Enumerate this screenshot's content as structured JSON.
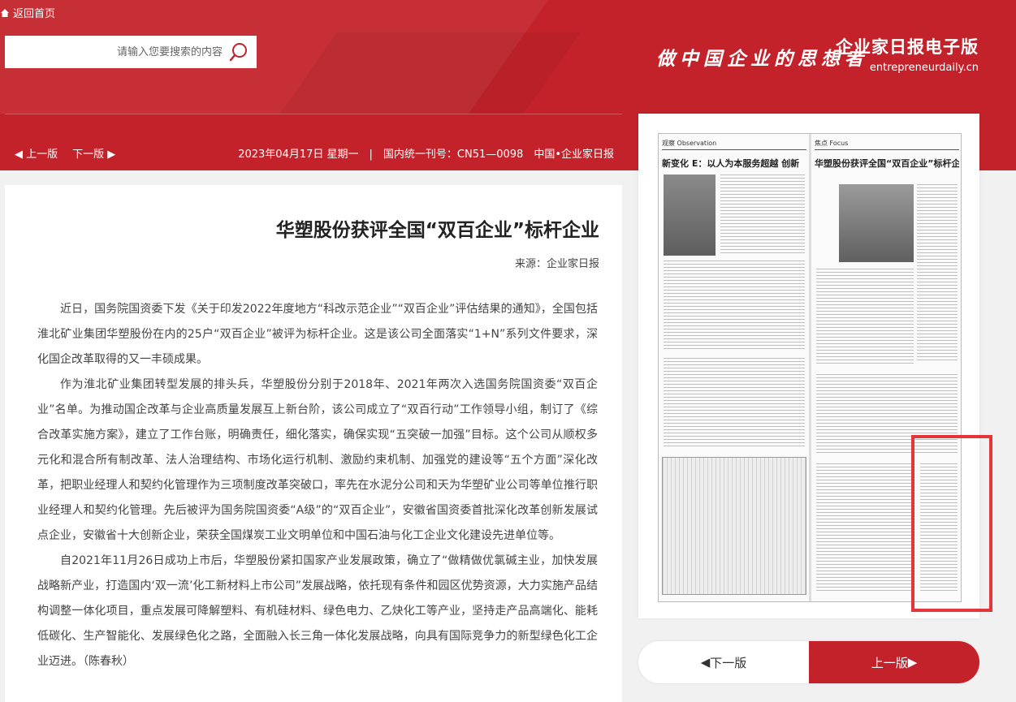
{
  "header": {
    "home_label": "返回首页",
    "search_placeholder": "请输入您要搜索的内容",
    "slogan": "做中国企业的思想者",
    "brand_title": "企业家日报电子版",
    "brand_url": "entrepreneurdaily.cn"
  },
  "infobar": {
    "prev_page_label": "上一版",
    "next_page_label": "下一版",
    "issue_info": "2023年04月17日 星期一　|　国内统一刊号：CN51—0098　中国•企业家日报"
  },
  "article": {
    "title": "华塑股份获评全国“双百企业”标杆企业",
    "source": "来源：企业家日报",
    "paragraphs": [
      "近日，国务院国资委下发《关于印发2022年度地方“科改示范企业”“双百企业”评估结果的通知》，全国包括淮北矿业集团华塑股份在内的25户“双百企业”被评为标杆企业。这是该公司全面落实“1+N”系列文件要求，深化国企改革取得的又一丰硕成果。",
      "作为淮北矿业集团转型发展的排头兵，华塑股份分别于2018年、2021年两次入选国务院国资委“双百企业”名单。为推动国企改革与企业高质量发展互上新台阶，该公司成立了“双百行动”工作领导小组，制订了《综合改革实施方案》，建立了工作台账，明确责任，细化落实，确保实现“五突破一加强”目标。这个公司从顺权多元化和混合所有制改革、法人治理结构、市场化运行机制、激励约束机制、加强党的建设等“五个方面”深化改革，把职业经理人和契约化管理作为三项制度改革突破口，率先在水泥分公司和天为华塑矿业公司等单位推行职业经理人和契约化管理。先后被评为国务院国资委“A级”的“双百企业”，安徽省国资委首批深化改革创新发展试点企业，安徽省十大创新企业，荣获全国煤炭工业文明单位和中国石油与化工企业文化建设先进单位等。",
      "自2021年11月26日成功上市后，华塑股份紧扣国家产业发展政策，确立了“做精做优氯碱主业，加快发展战略新产业，打造国内‘双一流’化工新材料上市公司”发展战略，依托现有条件和园区优势资源，大力实施产品结构调整一体化项目，重点发展可降解塑料、有机硅材料、绿色电力、乙炔化工等产业，坚持走产品高端化、能耗低碳化、生产智能化、发展绿色化之路，全面融入长三角一体化发展战略，向具有国际竞争力的新型绿色化工企业迈进。（陈春秋）"
    ]
  },
  "thumbnail": {
    "left_mast": "观察 Observation",
    "right_mast": "焦点 Focus",
    "left_headline": "新变化 E：以人为本服务超越 创新",
    "right_headline": "华塑股份获评全国“双百企业”标杆企业"
  },
  "pager": {
    "next_label": "下一版",
    "prev_label": "上一版"
  },
  "colors": {
    "brand_red": "#c4222a",
    "hotspot_border": "#e4353d"
  }
}
